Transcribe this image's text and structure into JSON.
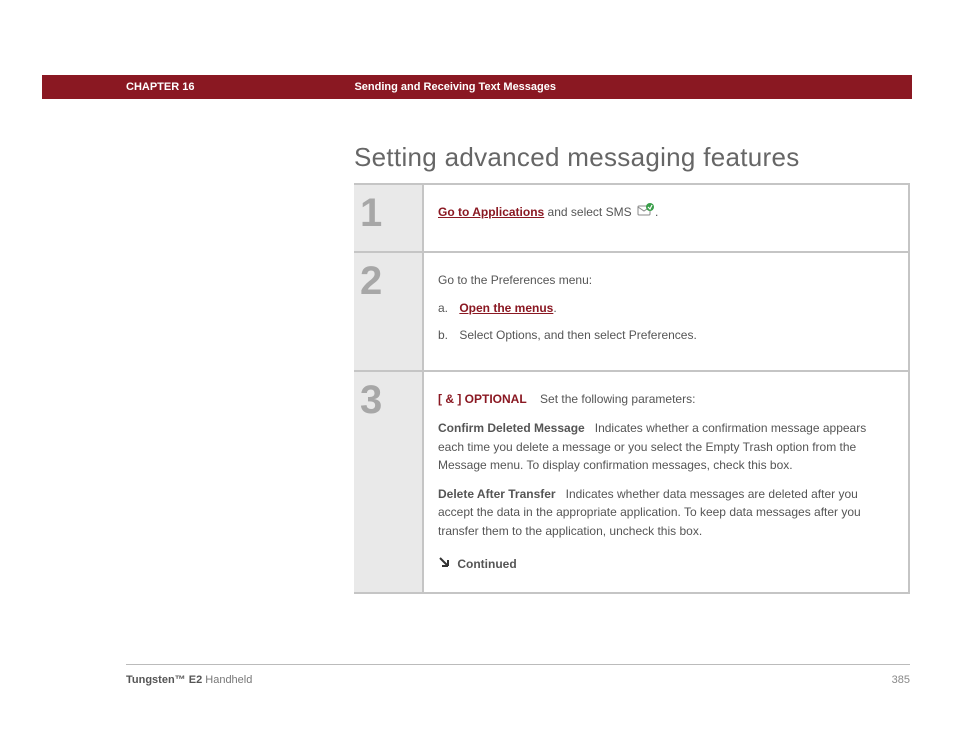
{
  "header": {
    "chapter_label": "CHAPTER 16",
    "chapter_title": "Sending and Receiving Text Messages"
  },
  "title": "Setting advanced messaging features",
  "steps": [
    {
      "num": "1",
      "link": "Go to Applications",
      "after_link": " and select SMS ",
      "period": "."
    },
    {
      "num": "2",
      "intro": "Go to the Preferences menu:",
      "a_letter": "a.",
      "a_link": "Open the menus",
      "a_after": ".",
      "b_letter": "b.",
      "b_text": "Select Options, and then select Preferences."
    },
    {
      "num": "3",
      "optional_prefix": "[ & ]  OPTIONAL",
      "optional_text": "Set the following parameters:",
      "param1_label": "Confirm Deleted Message",
      "param1_text": "Indicates whether a confirmation message appears each time you delete a message or you select the Empty Trash option from the Message menu. To display confirmation messages, check this box.",
      "param2_label": "Delete After Transfer",
      "param2_text": "Indicates whether data messages are deleted after you accept the data in the appropriate application. To keep data messages after you transfer them to the application, uncheck this box.",
      "continued": "Continued"
    }
  ],
  "footer": {
    "product_bold": "Tungsten™ E2",
    "product_rest": " Handheld",
    "page": "385"
  }
}
